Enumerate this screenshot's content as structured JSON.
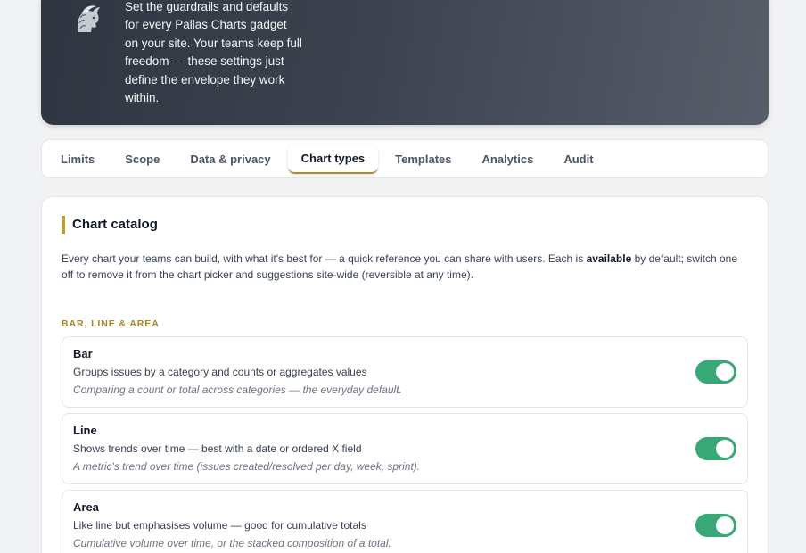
{
  "hero": {
    "logo_icon": "athena-helmet-icon",
    "description": "Set the guardrails and defaults for every Pallas Charts gadget on your site. Your teams keep full freedom — these settings just define the envelope they work within."
  },
  "tabs": [
    {
      "label": "Limits",
      "active": false
    },
    {
      "label": "Scope",
      "active": false
    },
    {
      "label": "Data & privacy",
      "active": false
    },
    {
      "label": "Chart types",
      "active": true
    },
    {
      "label": "Templates",
      "active": false
    },
    {
      "label": "Analytics",
      "active": false
    },
    {
      "label": "Audit",
      "active": false
    }
  ],
  "catalog": {
    "title": "Chart catalog",
    "desc_before": "Every chart your teams can build, with what it's best for — a quick reference you can share with users. Each is ",
    "desc_bold": "available",
    "desc_after": " by default; switch one off to remove it from the chart picker and suggestions site-wide (reversible at any time).",
    "section_title": "BAR, LINE & AREA",
    "items": [
      {
        "name": "Bar",
        "description": "Groups issues by a category and counts or aggregates values",
        "use": "Comparing a count or total across categories — the everyday default.",
        "enabled": true
      },
      {
        "name": "Line",
        "description": "Shows trends over time — best with a date or ordered X field",
        "use": "A metric's trend over time (issues created/resolved per day, week, sprint).",
        "enabled": true
      },
      {
        "name": "Area",
        "description": "Like line but emphasises volume — good for cumulative totals",
        "use": "Cumulative volume over time, or the stacked composition of a total.",
        "enabled": true
      }
    ]
  },
  "colors": {
    "accent": "#c09a35",
    "toggle_on": "#37a876",
    "hero_dark": "#2f3540"
  }
}
